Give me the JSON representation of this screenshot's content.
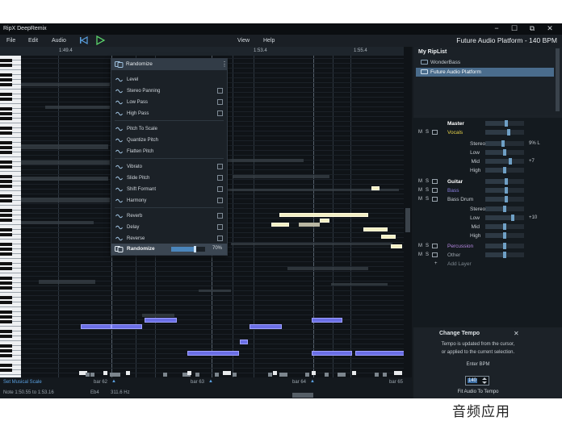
{
  "app": {
    "title": "RipX DeepRemix"
  },
  "window": {
    "minimize": "−",
    "maximize": "☐",
    "restore": "⧉",
    "close": "✕"
  },
  "menu": {
    "file": "File",
    "edit": "Edit",
    "audio": "Audio",
    "view": "View",
    "help": "Help"
  },
  "project": {
    "title": "Future Audio Platform - 140 BPM"
  },
  "timeline": {
    "ticks": [
      "1:49.4",
      "1:53.4",
      "1:55.4"
    ]
  },
  "dropdown": {
    "header": "Randomize",
    "header_menu_icon": "⋮",
    "items": [
      {
        "label": "Level",
        "icon": "level-icon",
        "toggle": false
      },
      {
        "label": "Stereo Panning",
        "icon": "pan-icon",
        "toggle": true
      },
      {
        "label": "Low Pass",
        "icon": "low-pass-icon",
        "toggle": true
      },
      {
        "label": "High Pass",
        "icon": "high-pass-icon",
        "toggle": true
      },
      {
        "label": "Pitch To Scale",
        "icon": "pitch-scale-icon",
        "toggle": false
      },
      {
        "label": "Quantize Pitch",
        "icon": "quantize-icon",
        "toggle": false
      },
      {
        "label": "Flatten Pitch",
        "icon": "flatten-icon",
        "toggle": false
      },
      {
        "label": "Vibrato",
        "icon": "vibrato-icon",
        "toggle": true
      },
      {
        "label": "Slide Pitch",
        "icon": "slide-icon",
        "toggle": true
      },
      {
        "label": "Shift Formant",
        "icon": "formant-icon",
        "toggle": true
      },
      {
        "label": "Harmony",
        "icon": "harmony-icon",
        "toggle": true
      },
      {
        "label": "Reverb",
        "icon": "reverb-icon",
        "toggle": true
      },
      {
        "label": "Delay",
        "icon": "delay-icon",
        "toggle": true
      },
      {
        "label": "Reverse",
        "icon": "reverse-icon",
        "toggle": true
      }
    ],
    "footer": {
      "label": "Randomize",
      "value_pct": 70,
      "value_text": "70%"
    }
  },
  "riplist": {
    "title": "My RipList",
    "items": [
      {
        "label": "WonderBass",
        "selected": false
      },
      {
        "label": "Future Audio Platform",
        "selected": true
      }
    ]
  },
  "mixer": {
    "rows": [
      {
        "name": "Master",
        "ms": false,
        "bold": true,
        "color": "#ffffff",
        "level": 0.55,
        "value": ""
      },
      {
        "name": "Vocals",
        "ms": true,
        "bold": false,
        "color": "#e6d24a",
        "level": 0.6,
        "value": ""
      },
      {
        "name": "Stereo",
        "ms": false,
        "bold": false,
        "color": "#c6ccd2",
        "level": 0.45,
        "value": "9% L",
        "sub": true
      },
      {
        "name": "Low",
        "ms": false,
        "bold": false,
        "color": "#c6ccd2",
        "level": 0.5,
        "value": "",
        "sub": true
      },
      {
        "name": "Mid",
        "ms": false,
        "bold": false,
        "color": "#c6ccd2",
        "level": 0.65,
        "value": "+7",
        "sub": true
      },
      {
        "name": "High",
        "ms": false,
        "bold": false,
        "color": "#c6ccd2",
        "level": 0.5,
        "value": "",
        "sub": true
      },
      {
        "name": "Guitar",
        "ms": true,
        "bold": true,
        "color": "#ffffff",
        "level": 0.55,
        "value": ""
      },
      {
        "name": "Bass",
        "ms": true,
        "bold": false,
        "color": "#8a7fe0",
        "level": 0.55,
        "value": ""
      },
      {
        "name": "Bass Drum",
        "ms": true,
        "bold": false,
        "color": "#c6ccd2",
        "level": 0.55,
        "value": ""
      },
      {
        "name": "Stereo",
        "ms": false,
        "bold": false,
        "color": "#c6ccd2",
        "level": 0.5,
        "value": "",
        "sub": true
      },
      {
        "name": "Low",
        "ms": false,
        "bold": false,
        "color": "#c6ccd2",
        "level": 0.7,
        "value": "+10",
        "sub": true
      },
      {
        "name": "Mid",
        "ms": false,
        "bold": false,
        "color": "#c6ccd2",
        "level": 0.5,
        "value": "",
        "sub": true
      },
      {
        "name": "High",
        "ms": false,
        "bold": false,
        "color": "#c6ccd2",
        "level": 0.5,
        "value": "",
        "sub": true
      },
      {
        "name": "Percussion",
        "ms": true,
        "bold": false,
        "color": "#b487e0",
        "level": 0.5,
        "value": ""
      },
      {
        "name": "Other",
        "ms": true,
        "bold": false,
        "color": "#9aa3ab",
        "level": 0.5,
        "value": ""
      },
      {
        "name": "Add Layer",
        "ms": false,
        "bold": false,
        "color": "#7e8890",
        "level": null,
        "value": "",
        "add": true
      }
    ]
  },
  "change_tempo": {
    "title": "Change Tempo",
    "close": "✕",
    "line1": "Tempo is updated from the cursor,",
    "line2": "or applied to the current selection.",
    "bpm_label": "Enter BPM",
    "bpm_value": "140",
    "fit_button": "Fit Audio To Tempo"
  },
  "bottom": {
    "scale_label": "Set Musical Scale",
    "bars": [
      "bar 62",
      "bar 63",
      "bar 64",
      "bar 65"
    ],
    "note_info": "Note 1:50.55 to 1:53.16",
    "note_name": "Eb4",
    "freq": "311.6 Hz"
  },
  "watermark": "音频应用"
}
